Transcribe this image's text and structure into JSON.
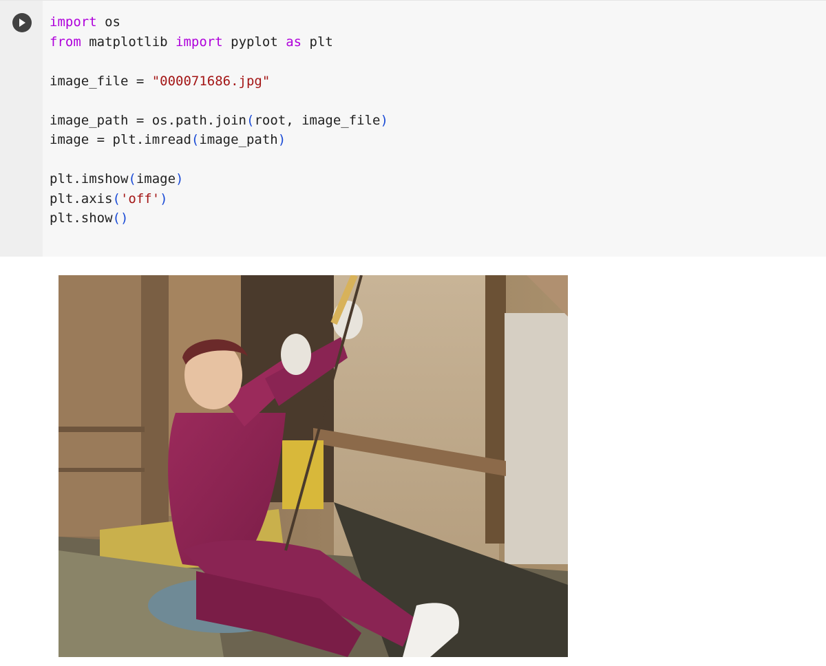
{
  "cell": {
    "run_icon": "play-icon",
    "code_lines": [
      [
        {
          "t": "import",
          "c": "kw"
        },
        {
          "t": " os",
          "c": ""
        }
      ],
      [
        {
          "t": "from",
          "c": "kw"
        },
        {
          "t": " matplotlib ",
          "c": ""
        },
        {
          "t": "import",
          "c": "kw"
        },
        {
          "t": " pyplot ",
          "c": ""
        },
        {
          "t": "as",
          "c": "kw"
        },
        {
          "t": " plt",
          "c": ""
        }
      ],
      [],
      [
        {
          "t": "image_file = ",
          "c": ""
        },
        {
          "t": "\"000071686.jpg\"",
          "c": "str"
        }
      ],
      [],
      [
        {
          "t": "image_path = os.path.join",
          "c": ""
        },
        {
          "t": "(",
          "c": "paren"
        },
        {
          "t": "root, image_file",
          "c": ""
        },
        {
          "t": ")",
          "c": "paren"
        }
      ],
      [
        {
          "t": "image = plt.imread",
          "c": ""
        },
        {
          "t": "(",
          "c": "paren"
        },
        {
          "t": "image_path",
          "c": ""
        },
        {
          "t": ")",
          "c": "paren"
        }
      ],
      [],
      [
        {
          "t": "plt.imshow",
          "c": ""
        },
        {
          "t": "(",
          "c": "paren"
        },
        {
          "t": "image",
          "c": ""
        },
        {
          "t": ")",
          "c": "paren"
        }
      ],
      [
        {
          "t": "plt.axis",
          "c": ""
        },
        {
          "t": "(",
          "c": "paren"
        },
        {
          "t": "'off'",
          "c": "str"
        },
        {
          "t": ")",
          "c": "paren"
        }
      ],
      [
        {
          "t": "plt.show",
          "c": ""
        },
        {
          "t": "()",
          "c": "paren"
        }
      ]
    ]
  },
  "output": {
    "image_kind": "photo-output"
  }
}
